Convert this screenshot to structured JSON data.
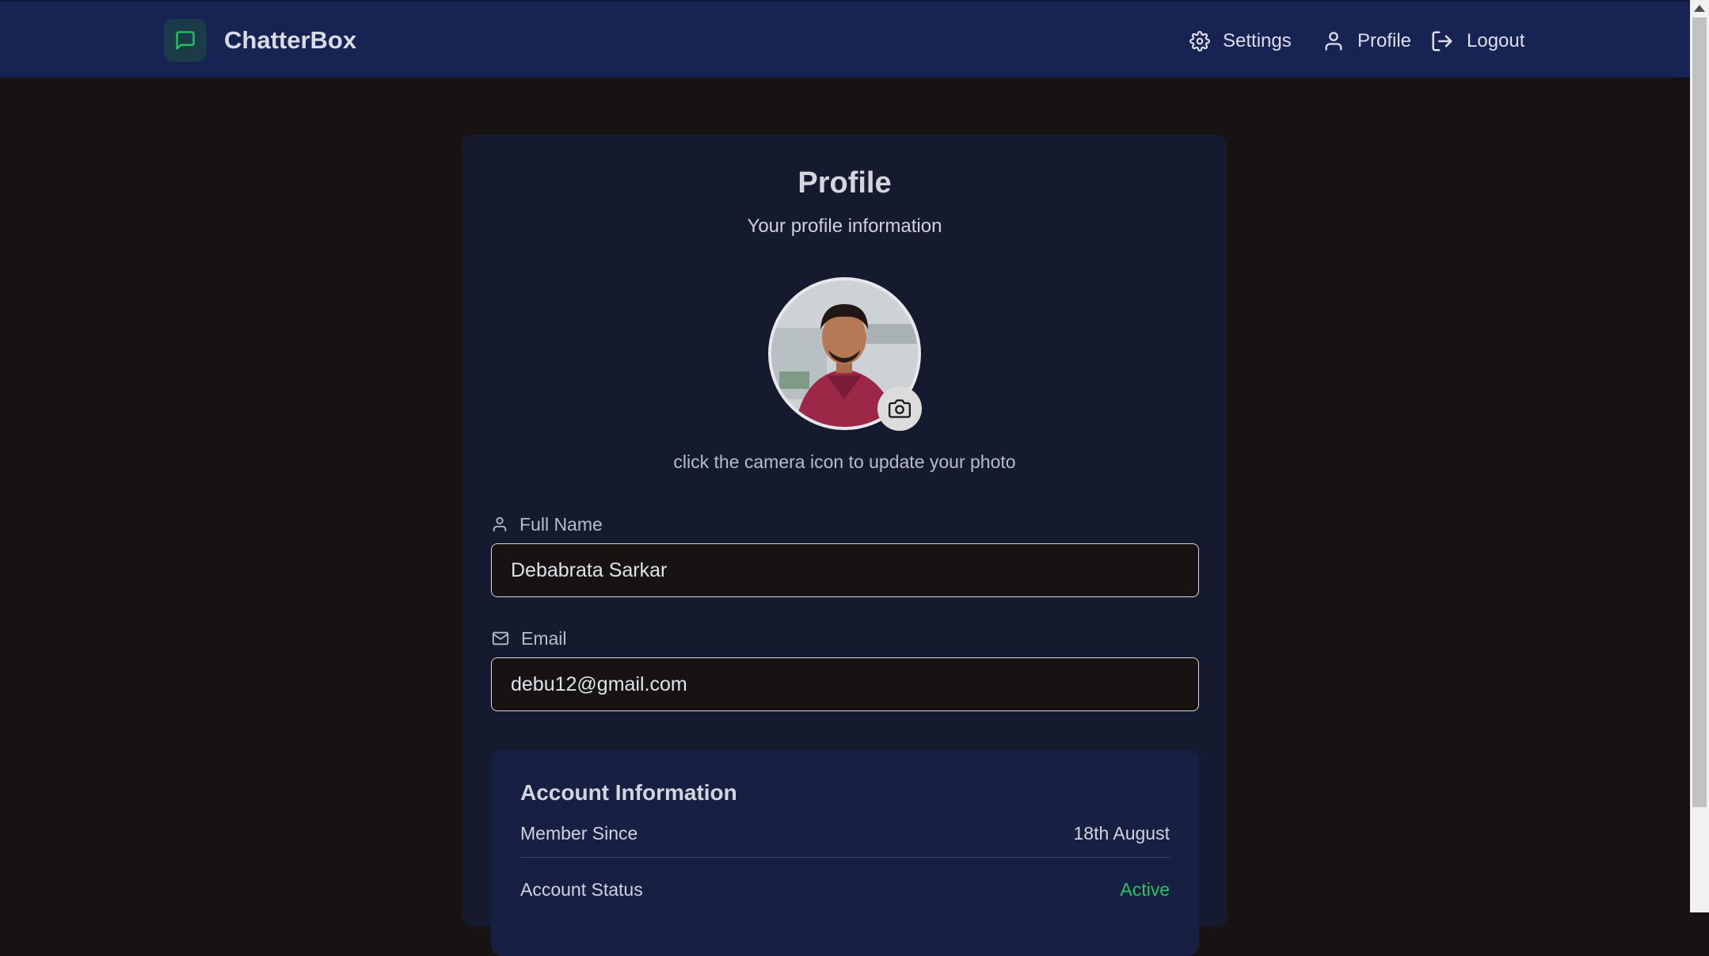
{
  "header": {
    "brand_name": "ChatterBox",
    "nav": {
      "settings": "Settings",
      "profile": "Profile",
      "logout": "Logout"
    }
  },
  "profile": {
    "title": "Profile",
    "subtitle": "Your profile information",
    "avatar_hint": "click the camera icon to update your photo",
    "full_name_label": "Full Name",
    "full_name_value": "Debabrata Sarkar",
    "email_label": "Email",
    "email_value": "debu12@gmail.com"
  },
  "account": {
    "title": "Account Information",
    "member_since_label": "Member Since",
    "member_since_value": "18th August",
    "status_label": "Account Status",
    "status_value": "Active"
  },
  "colors": {
    "header_bg": "#172453",
    "page_bg": "#161312",
    "card_bg": "#161a2e",
    "accent_green": "#22c55e"
  },
  "icons": {
    "brand": "message-square-icon",
    "settings": "gear-icon",
    "profile": "user-icon",
    "logout": "logout-icon",
    "camera": "camera-icon",
    "full_name": "user-icon",
    "email": "mail-icon"
  }
}
